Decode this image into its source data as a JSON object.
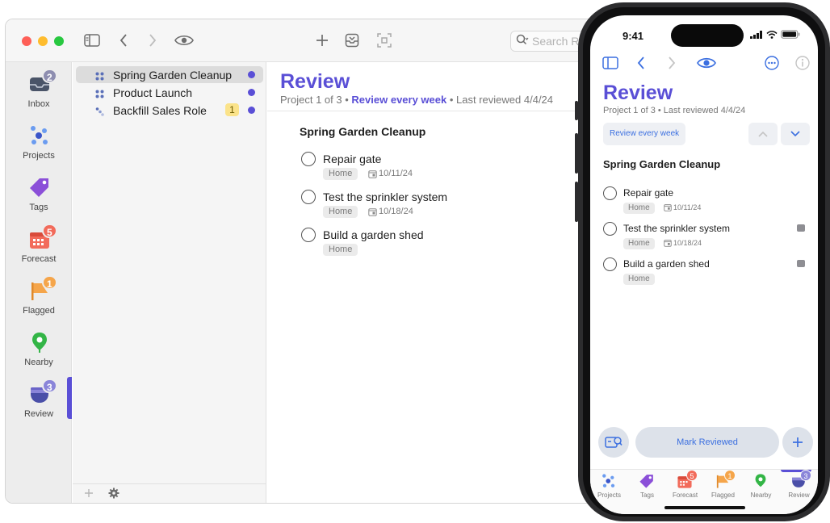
{
  "mac": {
    "toolbar": {
      "search_placeholder": "Search Review"
    },
    "rail": [
      {
        "label": "Inbox",
        "badge": "2",
        "badge_color": "#8e8eb0",
        "icon": "inbox-icon"
      },
      {
        "label": "Projects",
        "badge": "",
        "icon": "projects-icon"
      },
      {
        "label": "Tags",
        "badge": "",
        "icon": "tag-icon"
      },
      {
        "label": "Forecast",
        "badge": "5",
        "badge_color": "#f26b5b",
        "icon": "forecast-icon"
      },
      {
        "label": "Flagged",
        "badge": "1",
        "badge_color": "#f5a54a",
        "icon": "flag-icon"
      },
      {
        "label": "Nearby",
        "badge": "",
        "icon": "location-pin-icon"
      },
      {
        "label": "Review",
        "badge": "3",
        "badge_color": "#8a85d9",
        "icon": "review-icon"
      }
    ],
    "projects": [
      {
        "name": "Spring Garden Cleanup",
        "count": "",
        "selected": true
      },
      {
        "name": "Product Launch",
        "count": "",
        "selected": false
      },
      {
        "name": "Backfill Sales Role",
        "count": "1",
        "selected": false
      }
    ],
    "review": {
      "title": "Review",
      "position": "Project 1 of 3",
      "sep1": "•",
      "frequency": "Review every week",
      "sep2": "•",
      "last_reviewed": "Last reviewed 4/4/24",
      "project_name": "Spring Garden Cleanup",
      "tasks": [
        {
          "name": "Repair gate",
          "tag": "Home",
          "due": "10/11/24"
        },
        {
          "name": "Test the sprinkler system",
          "tag": "Home",
          "due": "10/18/24"
        },
        {
          "name": "Build a garden shed",
          "tag": "Home",
          "due": ""
        }
      ]
    }
  },
  "phone": {
    "time": "9:41",
    "title": "Review",
    "subtitle": "Project 1 of 3 • Last reviewed 4/4/24",
    "review_button": "Review every week",
    "project_name": "Spring Garden Cleanup",
    "tasks": [
      {
        "name": "Repair gate",
        "tag": "Home",
        "due": "10/11/24",
        "note": false
      },
      {
        "name": "Test the sprinkler system",
        "tag": "Home",
        "due": "10/18/24",
        "note": true
      },
      {
        "name": "Build a garden shed",
        "tag": "Home",
        "due": "",
        "note": true
      }
    ],
    "mark_reviewed": "Mark Reviewed",
    "tabs": [
      {
        "label": "Projects",
        "badge": ""
      },
      {
        "label": "Tags",
        "badge": ""
      },
      {
        "label": "Forecast",
        "badge": "5"
      },
      {
        "label": "Flagged",
        "badge": "1"
      },
      {
        "label": "Nearby",
        "badge": ""
      },
      {
        "label": "Review",
        "badge": "3"
      }
    ]
  },
  "colors": {
    "accent": "#5a4fd6",
    "link_blue": "#3b6fe0"
  }
}
